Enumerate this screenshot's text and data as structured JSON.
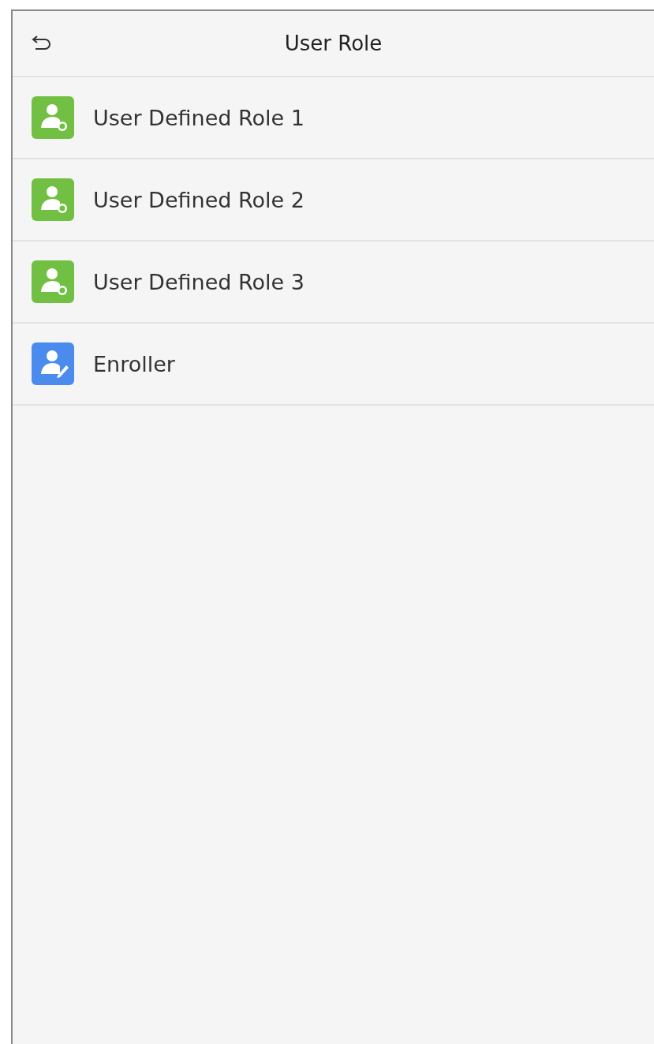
{
  "header": {
    "title": "User Role"
  },
  "roles": [
    {
      "label": "User Defined Role 1",
      "kind": "custom"
    },
    {
      "label": "User Defined Role 2",
      "kind": "custom"
    },
    {
      "label": "User Defined Role 3",
      "kind": "custom"
    },
    {
      "label": "Enroller",
      "kind": "enroller"
    }
  ]
}
